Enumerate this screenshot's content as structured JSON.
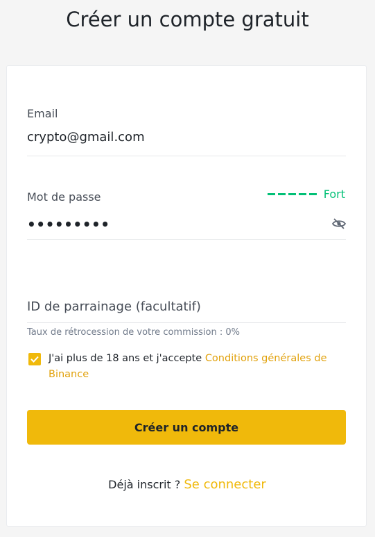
{
  "page": {
    "title": "Créer un compte gratuit"
  },
  "form": {
    "email": {
      "label": "Email",
      "value": "crypto@gmail.com"
    },
    "password": {
      "label": "Mot de passe",
      "value_masked": "•••••••••",
      "strength_label": "Fort",
      "toggle_icon": "eye-slash-icon"
    },
    "referral": {
      "placeholder": "ID de parrainage (facultatif)",
      "commission_text": "Taux de rétrocession de votre commission : 0%"
    },
    "terms": {
      "checked": true,
      "text": "J'ai plus de 18 ans et j'accepte ",
      "link_text": "Conditions générales de Binance"
    },
    "submit_label": "Créer un compte",
    "login": {
      "prompt": "Déjà inscrit ? ",
      "link_text": "Se connecter"
    }
  },
  "colors": {
    "accent": "#f0b90b",
    "strength": "#02c076",
    "link": "#e1a10b"
  }
}
